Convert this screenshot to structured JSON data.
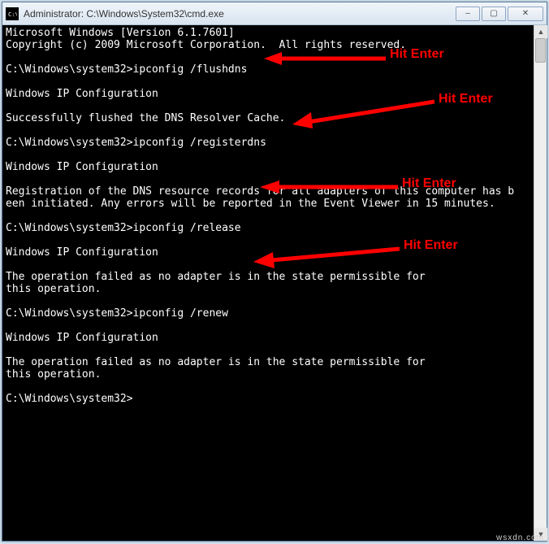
{
  "titlebar": {
    "icon_label": "C:\\",
    "title": "Administrator: C:\\Windows\\System32\\cmd.exe"
  },
  "window_controls": {
    "minimize": "–",
    "maximize": "▢",
    "close": "✕"
  },
  "terminal_lines": [
    "Microsoft Windows [Version 6.1.7601]",
    "Copyright (c) 2009 Microsoft Corporation.  All rights reserved.",
    "",
    "C:\\Windows\\system32>ipconfig /flushdns",
    "",
    "Windows IP Configuration",
    "",
    "Successfully flushed the DNS Resolver Cache.",
    "",
    "C:\\Windows\\system32>ipconfig /registerdns",
    "",
    "Windows IP Configuration",
    "",
    "Registration of the DNS resource records for all adapters of this computer has b",
    "een initiated. Any errors will be reported in the Event Viewer in 15 minutes.",
    "",
    "C:\\Windows\\system32>ipconfig /release",
    "",
    "Windows IP Configuration",
    "",
    "The operation failed as no adapter is in the state permissible for",
    "this operation.",
    "",
    "C:\\Windows\\system32>ipconfig /renew",
    "",
    "Windows IP Configuration",
    "",
    "The operation failed as no adapter is in the state permissible for",
    "this operation.",
    "",
    "C:\\Windows\\system32>"
  ],
  "annotations": {
    "a1": "Hit Enter",
    "a2": "Hit Enter",
    "a3": "Hit Enter",
    "a4": "Hit Enter"
  },
  "scrollbar": {
    "up": "▲",
    "down": "▼"
  },
  "watermark": "wsxdn.com"
}
